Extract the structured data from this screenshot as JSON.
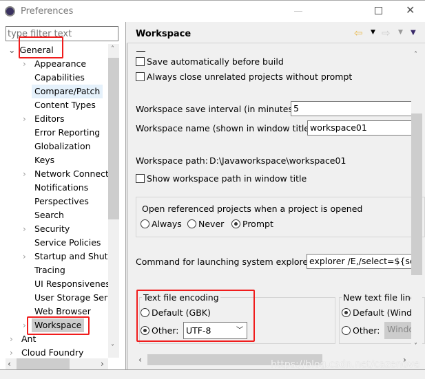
{
  "window": {
    "title": "Preferences",
    "minimize_icon": "minimize-icon",
    "maximize_icon": "maximize-icon",
    "close_icon": "close-icon"
  },
  "filter": {
    "placeholder": "type filter text"
  },
  "tree": {
    "root": "General",
    "children": [
      {
        "label": "Appearance",
        "expandable": true
      },
      {
        "label": "Capabilities",
        "expandable": false
      },
      {
        "label": "Compare/Patch",
        "expandable": false,
        "hover": true
      },
      {
        "label": "Content Types",
        "expandable": false
      },
      {
        "label": "Editors",
        "expandable": true
      },
      {
        "label": "Error Reporting",
        "expandable": false
      },
      {
        "label": "Globalization",
        "expandable": false
      },
      {
        "label": "Keys",
        "expandable": false
      },
      {
        "label": "Network Connecti",
        "expandable": true
      },
      {
        "label": "Notifications",
        "expandable": false
      },
      {
        "label": "Perspectives",
        "expandable": false
      },
      {
        "label": "Search",
        "expandable": false
      },
      {
        "label": "Security",
        "expandable": true
      },
      {
        "label": "Service Policies",
        "expandable": false
      },
      {
        "label": "Startup and Shutd",
        "expandable": true
      },
      {
        "label": "Tracing",
        "expandable": false
      },
      {
        "label": "UI Responsiveness",
        "expandable": false
      },
      {
        "label": "User Storage Serv",
        "expandable": false
      },
      {
        "label": "Web Browser",
        "expandable": false
      },
      {
        "label": "Workspace",
        "expandable": true,
        "selected": true
      }
    ],
    "siblings": [
      "Ant",
      "Cloud Foundry"
    ]
  },
  "page": {
    "title": "Workspace",
    "save_before_build": {
      "label": "Save automatically before build",
      "checked": false
    },
    "close_unrelated": {
      "label": "Always close unrelated projects without prompt",
      "checked": false
    },
    "save_interval": {
      "label": "Workspace save interval (in minutes):",
      "value": "5"
    },
    "workspace_name": {
      "label": "Workspace name (shown in window title):",
      "value": "workspace01"
    },
    "workspace_path": {
      "label": "Workspace path:",
      "value": "D:\\Javaworkspace\\workspace01"
    },
    "show_path": {
      "label": "Show workspace path in window title",
      "checked": false
    },
    "open_referenced": {
      "legend": "Open referenced projects when a project is opened",
      "options": [
        "Always",
        "Never",
        "Prompt"
      ],
      "selected": "Prompt"
    },
    "explorer_cmd": {
      "label": "Command for launching system explorer:",
      "value": "explorer /E,/select=${sele"
    },
    "encoding": {
      "legend": "Text file encoding",
      "default_label": "Default (GBK)",
      "other_label": "Other:",
      "selected": "Other",
      "other_value": "UTF-8"
    },
    "line_delimiter": {
      "legend": "New text file line",
      "default_label": "Default (Windo",
      "other_label": "Other:",
      "selected": "Default",
      "other_value": "Windo"
    }
  },
  "watermark": "https://blog.csdn.net/cazenove",
  "colors": {
    "highlight": "#f01c1c",
    "selected_bg": "#cccccc",
    "hover_bg": "#e5f1fb",
    "back_arrow": "#e8b84a"
  }
}
